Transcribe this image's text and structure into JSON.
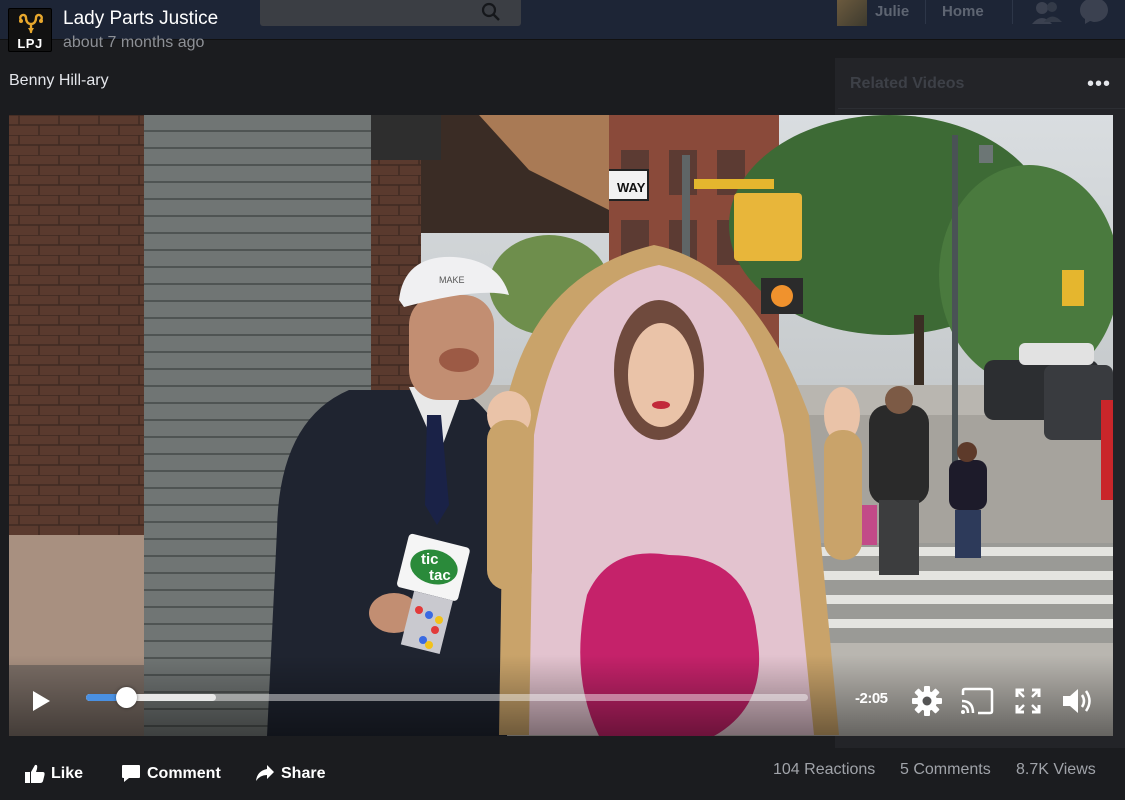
{
  "background_page": {
    "user_name": "Julie",
    "home_label": "Home",
    "related_title": "Related Videos"
  },
  "post": {
    "page_name": "Lady Parts Justice",
    "logo_text": "LPJ",
    "timestamp": "about 7 months ago",
    "caption": "Benny Hill-ary",
    "more_label": "•••"
  },
  "video": {
    "time_remaining": "-2:05",
    "progress_fraction": 0.055,
    "buffered_fraction": 0.18,
    "scene_signs": {
      "one_way": "WAY",
      "hat_text": "MAKE",
      "candy_brand_top": "tic",
      "candy_brand_bottom": "tac"
    }
  },
  "actions": {
    "like_label": "Like",
    "comment_label": "Comment",
    "share_label": "Share"
  },
  "stats": {
    "reactions": "104 Reactions",
    "comments": "5 Comments",
    "views": "8.7K Views"
  },
  "colors": {
    "progress_played": "#4a90e2",
    "page_background": "#1b1c1f",
    "top_bar": "#1d2536"
  },
  "icons": {
    "logo": "uterus-logo-icon",
    "play": "play-icon",
    "settings": "gear-icon",
    "cast": "cast-icon",
    "fullscreen": "fullscreen-icon",
    "volume": "volume-icon",
    "like": "thumbs-up-icon",
    "comment": "comment-bubble-icon",
    "share": "share-arrow-icon",
    "search": "search-icon",
    "friends": "friends-icon",
    "messenger": "messenger-icon"
  }
}
